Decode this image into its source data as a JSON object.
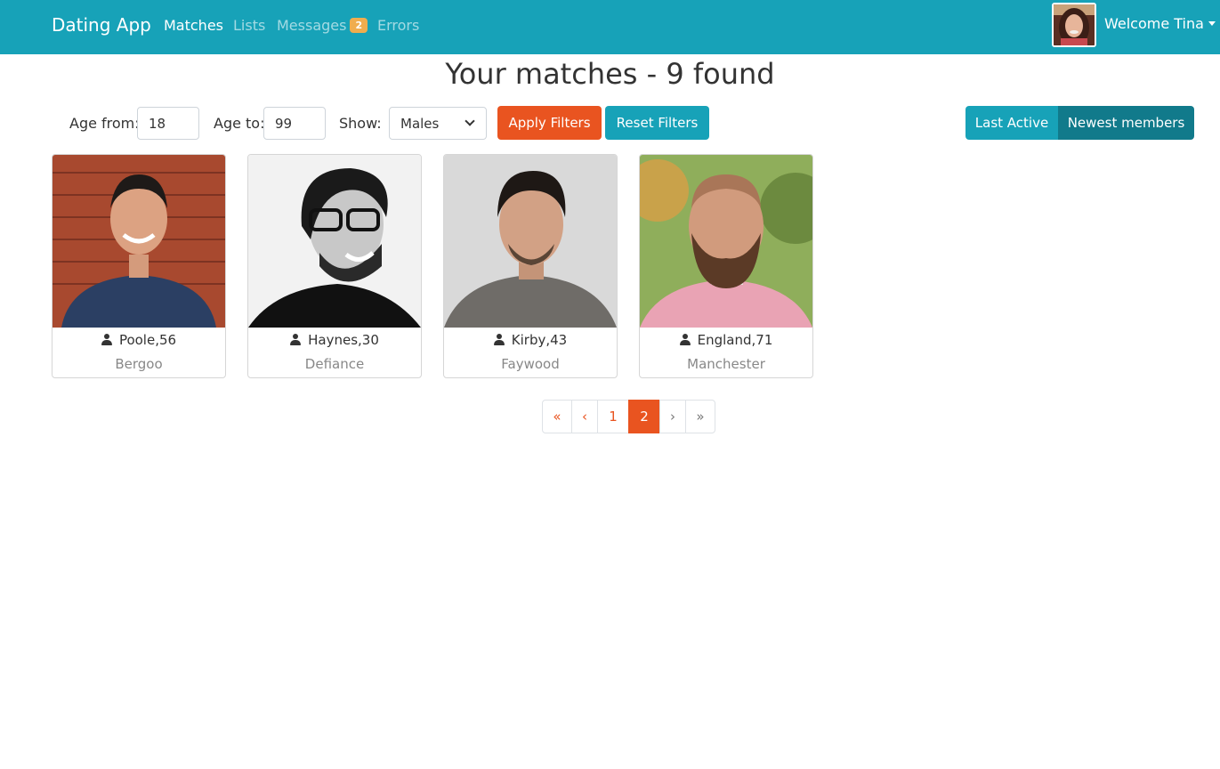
{
  "navbar": {
    "brand": "Dating App",
    "links": [
      {
        "label": "Matches",
        "active": true
      },
      {
        "label": "Lists",
        "active": false
      },
      {
        "label": "Messages",
        "active": false,
        "badge": "2"
      },
      {
        "label": "Errors",
        "active": false
      }
    ],
    "welcome": "Welcome Tina"
  },
  "page": {
    "title": "Your matches - 9 found"
  },
  "filters": {
    "age_from_label": "Age from:",
    "age_from_value": "18",
    "age_to_label": "Age to:",
    "age_to_value": "99",
    "show_label": "Show:",
    "show_value": "Males",
    "apply_label": "Apply Filters",
    "reset_label": "Reset Filters"
  },
  "sort": {
    "last_active": "Last Active",
    "newest": "Newest members",
    "selected": "Newest members"
  },
  "members": [
    {
      "name_age": "Poole,56",
      "city": "Bergoo"
    },
    {
      "name_age": "Haynes,30",
      "city": "Defiance"
    },
    {
      "name_age": "Kirby,43",
      "city": "Faywood"
    },
    {
      "name_age": "England,71",
      "city": "Manchester"
    }
  ],
  "pagination": {
    "first": "«",
    "prev": "‹",
    "pages": [
      "1",
      "2"
    ],
    "current": "2",
    "next": "›",
    "last": "»"
  },
  "colors": {
    "primary": "#17a2b8",
    "accent": "#e95420",
    "badge": "#f0ad4e",
    "active_sort": "#117a8b"
  }
}
